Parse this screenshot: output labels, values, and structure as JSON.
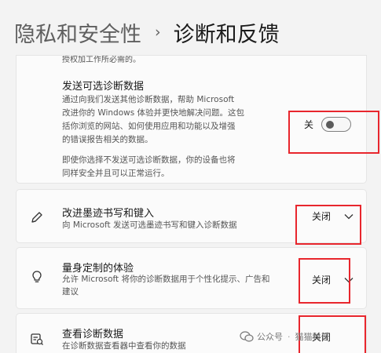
{
  "header": {
    "parent": "隐私和安全性",
    "separator": "›",
    "current": "诊断和反馈"
  },
  "clipped_text": "授权加工作所必需的。",
  "optional_data": {
    "title": "发送可选诊断数据",
    "description_lines": [
      "通过向我们发送其他诊断数据，帮助 Microsoft",
      "改进你的 Windows 体验并更快地解决问题。这包",
      "括你浏览的网站、如何使用应用和功能以及增强",
      "的错误报告相关的数据。"
    ],
    "note_lines": [
      "即使你选择不发送可选诊断数据，你的设备也将",
      "同样安全并且可以正常运行。"
    ],
    "toggle_label": "关",
    "toggle_on": false
  },
  "settings": [
    {
      "title": "改进墨迹书写和键入",
      "subtitle_lines": [
        "向 Microsoft 发送可选墨迹书写和键入诊断数据"
      ],
      "value": "关闭",
      "icon": "pen-icon"
    },
    {
      "title": "量身定制的体验",
      "subtitle_lines": [
        "允许 Microsoft 将你的诊断数据用于个性化提示、广告和",
        "建议"
      ],
      "value": "关闭",
      "icon": "lightbulb-icon"
    },
    {
      "title": "查看诊断数据",
      "subtitle_lines": [
        "在诊断数据查看器中查看你的数据"
      ],
      "value": "关闭",
      "icon": "diagnostic-viewer-icon"
    }
  ],
  "watermark": {
    "channel": "公众号",
    "author": "猫猫科普"
  },
  "colors": {
    "background": "#f3f3f3",
    "card": "#fbfbfb",
    "callout": "#e8262d"
  }
}
